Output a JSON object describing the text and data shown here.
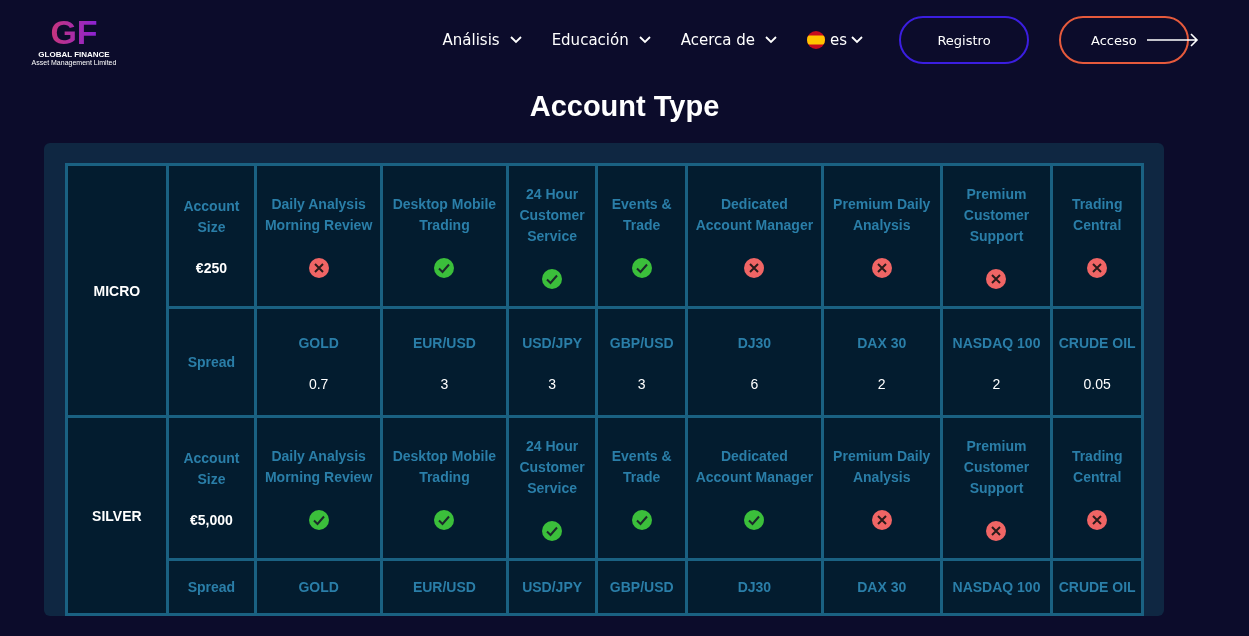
{
  "header": {
    "logo": {
      "mark": "GF",
      "name": "GLOBAL FINANCE",
      "tagline": "Asset Management Limited"
    },
    "nav": [
      {
        "label": "Análisis"
      },
      {
        "label": "Educación"
      },
      {
        "label": "Acerca de"
      }
    ],
    "language": "es",
    "buttons": [
      {
        "label": "Registro",
        "kind": "outline-blue"
      },
      {
        "label": "Acceso",
        "kind": "outline-orange-arrow"
      }
    ]
  },
  "title": "Account Type",
  "plans": [
    {
      "name": "MICRO",
      "size_label": "Account Size",
      "size": "€250",
      "spread_label": "Spread",
      "features": [
        {
          "label": "Daily Analysis Morning Review",
          "included": false
        },
        {
          "label": "Desktop Mobile Trading",
          "included": true
        },
        {
          "label": "24 Hour Customer Service",
          "included": true
        },
        {
          "label": "Events & Trade",
          "included": true
        },
        {
          "label": "Dedicated Account Manager",
          "included": false
        },
        {
          "label": "Premium Daily Analysis",
          "included": false
        },
        {
          "label": "Premium Customer Support",
          "included": false
        },
        {
          "label": "Trading Central",
          "included": false
        }
      ],
      "spreads": [
        {
          "instrument": "GOLD",
          "value": "0.7"
        },
        {
          "instrument": "EUR/USD",
          "value": "3"
        },
        {
          "instrument": "USD/JPY",
          "value": "3"
        },
        {
          "instrument": "GBP/USD",
          "value": "3"
        },
        {
          "instrument": "DJ30",
          "value": "6"
        },
        {
          "instrument": "DAX 30",
          "value": "2"
        },
        {
          "instrument": "NASDAQ 100",
          "value": "2"
        },
        {
          "instrument": "CRUDE OIL",
          "value": "0.05"
        }
      ]
    },
    {
      "name": "SILVER",
      "size_label": "Account Size",
      "size": "€5,000",
      "spread_label": "Spread",
      "features": [
        {
          "label": "Daily Analysis Morning Review",
          "included": true
        },
        {
          "label": "Desktop Mobile Trading",
          "included": true
        },
        {
          "label": "24 Hour Customer Service",
          "included": true
        },
        {
          "label": "Events & Trade",
          "included": true
        },
        {
          "label": "Dedicated Account Manager",
          "included": true
        },
        {
          "label": "Premium Daily Analysis",
          "included": false
        },
        {
          "label": "Premium Customer Support",
          "included": false
        },
        {
          "label": "Trading Central",
          "included": false
        }
      ],
      "spreads": [
        {
          "instrument": "GOLD"
        },
        {
          "instrument": "EUR/USD"
        },
        {
          "instrument": "USD/JPY"
        },
        {
          "instrument": "GBP/USD"
        },
        {
          "instrument": "DJ30"
        },
        {
          "instrument": "DAX 30"
        },
        {
          "instrument": "NASDAQ 100"
        },
        {
          "instrument": "CRUDE OIL"
        }
      ]
    }
  ]
}
